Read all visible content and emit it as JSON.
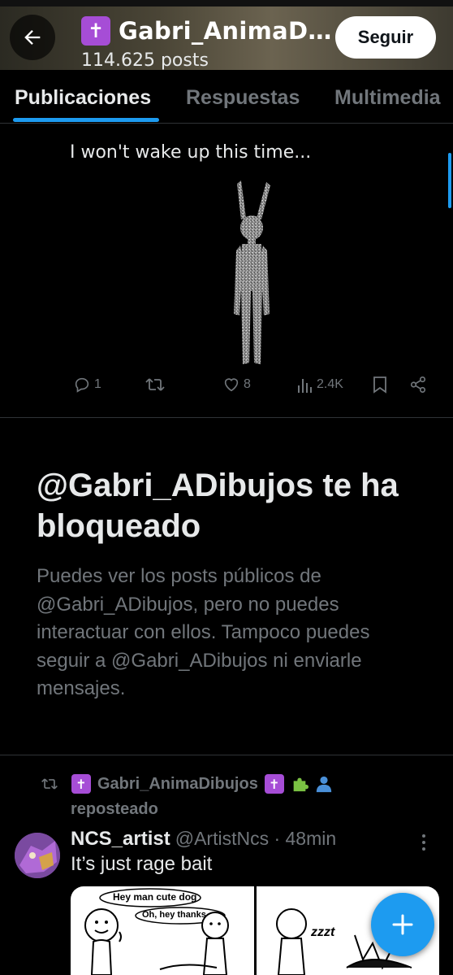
{
  "header": {
    "back_icon": "arrow-left-icon",
    "badge": "✝️",
    "title": "Gabri_AnimaD…",
    "post_count": "114.625 posts",
    "follow_label": "Seguir"
  },
  "tabs": [
    {
      "label": "Publicaciones",
      "active": true
    },
    {
      "label": "Respuestas",
      "active": false
    },
    {
      "label": "Multimedia",
      "active": false
    }
  ],
  "post": {
    "caption": "I won't wake up this time...",
    "actions": {
      "replies": "1",
      "reposts": "",
      "likes": "8",
      "views": "2.4K"
    }
  },
  "blocked": {
    "title": "@Gabri_ADibujos te ha bloqueado",
    "description": "Puedes ver los posts públicos de @Gabri_ADibujos, pero no puedes interactuar con ellos. Tampoco puedes seguir a @Gabri_ADibujos ni enviarle mensajes."
  },
  "repost": {
    "name": "Gabri_AnimaDibujos",
    "badge": "✝️",
    "emojis": "🧩👤",
    "label": "reposteado"
  },
  "next_post": {
    "author_name": "NCS_artist",
    "author_handle": "@ArtistNcs · 48min",
    "text": "It’s just rage bait",
    "comic": {
      "bubble1": "Hey man cute dog",
      "bubble2": "Oh, hey thanks",
      "bubble3": "zzzt"
    }
  },
  "fab_label": "+",
  "colors": {
    "accent": "#1d9bf0",
    "background": "#000000",
    "muted_text": "#71767b",
    "primary_text": "#e7e9ea",
    "badge_purple": "#a64dd6"
  }
}
